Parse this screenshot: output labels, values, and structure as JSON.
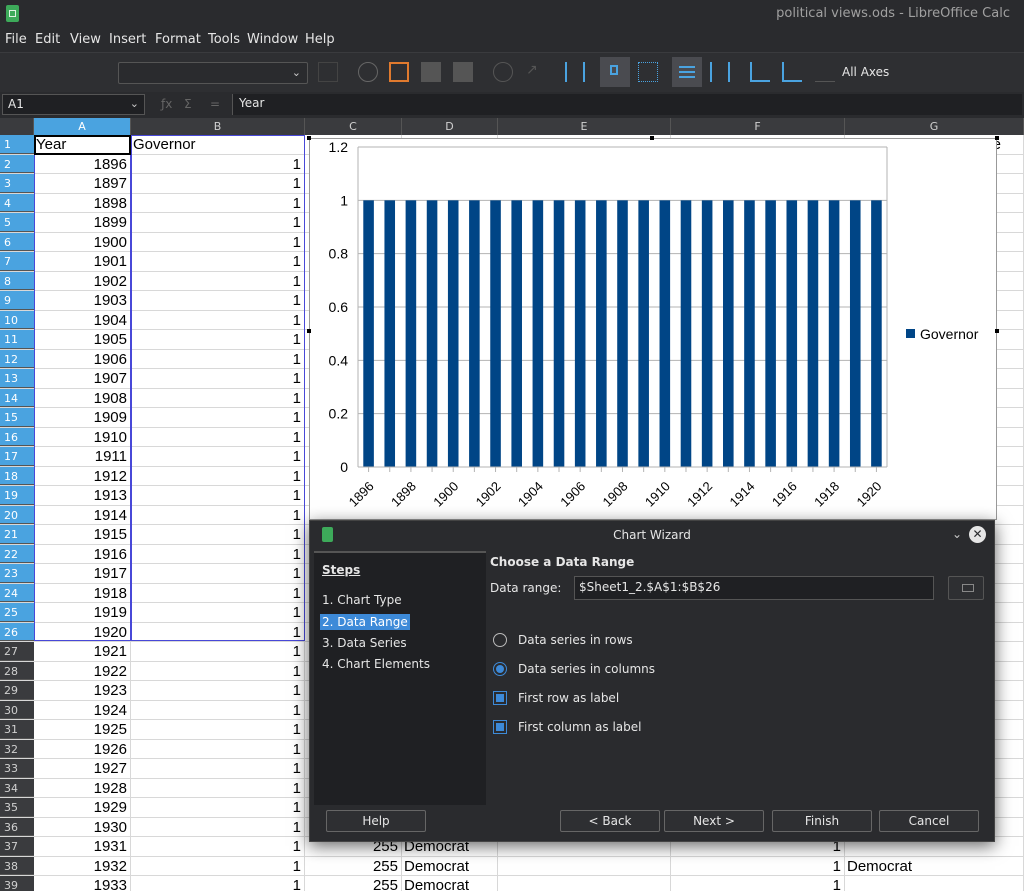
{
  "window": {
    "title": "political views.ods - LibreOffice Calc"
  },
  "menu": [
    "File",
    "Edit",
    "View",
    "Insert",
    "Format",
    "Tools",
    "Window",
    "Help"
  ],
  "toolbar": {
    "axes_label": "All Axes",
    "chart_element_select": ""
  },
  "formula_bar": {
    "cell_ref": "A1",
    "content": "Year"
  },
  "columns": [
    "A",
    "B",
    "C",
    "D",
    "E",
    "F",
    "G"
  ],
  "header_row": {
    "num": "1",
    "a": "Year",
    "b": "Governor",
    "g_partial": "e"
  },
  "rows": [
    {
      "num": "2",
      "a": "1896",
      "b": "1",
      "c": "",
      "d": "",
      "f": "",
      "g": ""
    },
    {
      "num": "3",
      "a": "1897",
      "b": "1",
      "c": "",
      "d": "",
      "f": "",
      "g": ""
    },
    {
      "num": "4",
      "a": "1898",
      "b": "1",
      "c": "",
      "d": "",
      "f": "",
      "g": ""
    },
    {
      "num": "5",
      "a": "1899",
      "b": "1",
      "c": "",
      "d": "",
      "f": "",
      "g": ""
    },
    {
      "num": "6",
      "a": "1900",
      "b": "1",
      "c": "",
      "d": "",
      "f": "",
      "g": ""
    },
    {
      "num": "7",
      "a": "1901",
      "b": "1",
      "c": "",
      "d": "",
      "f": "",
      "g": ""
    },
    {
      "num": "8",
      "a": "1902",
      "b": "1",
      "c": "",
      "d": "",
      "f": "",
      "g": ""
    },
    {
      "num": "9",
      "a": "1903",
      "b": "1",
      "c": "",
      "d": "",
      "f": "",
      "g": ""
    },
    {
      "num": "10",
      "a": "1904",
      "b": "1",
      "c": "",
      "d": "",
      "f": "",
      "g": ""
    },
    {
      "num": "11",
      "a": "1905",
      "b": "1",
      "c": "",
      "d": "",
      "f": "",
      "g": ""
    },
    {
      "num": "12",
      "a": "1906",
      "b": "1",
      "c": "",
      "d": "",
      "f": "",
      "g": ""
    },
    {
      "num": "13",
      "a": "1907",
      "b": "1",
      "c": "",
      "d": "",
      "f": "",
      "g": ""
    },
    {
      "num": "14",
      "a": "1908",
      "b": "1",
      "c": "",
      "d": "",
      "f": "",
      "g": ""
    },
    {
      "num": "15",
      "a": "1909",
      "b": "1",
      "c": "",
      "d": "",
      "f": "",
      "g": ""
    },
    {
      "num": "16",
      "a": "1910",
      "b": "1",
      "c": "",
      "d": "",
      "f": "",
      "g": ""
    },
    {
      "num": "17",
      "a": "1911",
      "b": "1",
      "c": "",
      "d": "",
      "f": "",
      "g": ""
    },
    {
      "num": "18",
      "a": "1912",
      "b": "1",
      "c": "",
      "d": "",
      "f": "",
      "g": ""
    },
    {
      "num": "19",
      "a": "1913",
      "b": "1",
      "c": "",
      "d": "",
      "f": "",
      "g": ""
    },
    {
      "num": "20",
      "a": "1914",
      "b": "1",
      "c": "",
      "d": "",
      "f": "",
      "g": ""
    },
    {
      "num": "21",
      "a": "1915",
      "b": "1",
      "c": "",
      "d": "",
      "f": "",
      "g": ""
    },
    {
      "num": "22",
      "a": "1916",
      "b": "1",
      "c": "",
      "d": "",
      "f": "",
      "g": ""
    },
    {
      "num": "23",
      "a": "1917",
      "b": "1",
      "c": "",
      "d": "",
      "f": "",
      "g": ""
    },
    {
      "num": "24",
      "a": "1918",
      "b": "1",
      "c": "",
      "d": "",
      "f": "",
      "g": ""
    },
    {
      "num": "25",
      "a": "1919",
      "b": "1",
      "c": "",
      "d": "",
      "f": "",
      "g": ""
    },
    {
      "num": "26",
      "a": "1920",
      "b": "1",
      "c": "",
      "d": "",
      "f": "",
      "g": ""
    },
    {
      "num": "27",
      "a": "1921",
      "b": "1",
      "c": "",
      "d": "",
      "f": "",
      "g": ""
    },
    {
      "num": "28",
      "a": "1922",
      "b": "1",
      "c": "",
      "d": "",
      "f": "",
      "g": ""
    },
    {
      "num": "29",
      "a": "1923",
      "b": "1",
      "c": "",
      "d": "",
      "f": "",
      "g": ""
    },
    {
      "num": "30",
      "a": "1924",
      "b": "1",
      "c": "",
      "d": "",
      "f": "",
      "g": ""
    },
    {
      "num": "31",
      "a": "1925",
      "b": "1",
      "c": "",
      "d": "",
      "f": "",
      "g": ""
    },
    {
      "num": "32",
      "a": "1926",
      "b": "1",
      "c": "",
      "d": "",
      "f": "",
      "g": ""
    },
    {
      "num": "33",
      "a": "1927",
      "b": "1",
      "c": "",
      "d": "",
      "f": "",
      "g": ""
    },
    {
      "num": "34",
      "a": "1928",
      "b": "1",
      "c": "",
      "d": "",
      "f": "",
      "g": ""
    },
    {
      "num": "35",
      "a": "1929",
      "b": "1",
      "c": "",
      "d": "",
      "f": "",
      "g": ""
    },
    {
      "num": "36",
      "a": "1930",
      "b": "1",
      "c": "",
      "d": "",
      "f": "",
      "g": ""
    },
    {
      "num": "37",
      "a": "1931",
      "b": "1",
      "c": "255",
      "d": "Democrat",
      "f": "1",
      "g": ""
    },
    {
      "num": "38",
      "a": "1932",
      "b": "1",
      "c": "255",
      "d": "Democrat",
      "f": "1",
      "g": "Democrat"
    },
    {
      "num": "39",
      "a": "1933",
      "b": "1",
      "c": "255",
      "d": "Democrat",
      "f": "1",
      "g": ""
    }
  ],
  "chart_data": {
    "type": "bar",
    "categories": [
      "1896",
      "1897",
      "1898",
      "1899",
      "1900",
      "1901",
      "1902",
      "1903",
      "1904",
      "1905",
      "1906",
      "1907",
      "1908",
      "1909",
      "1910",
      "1911",
      "1912",
      "1913",
      "1914",
      "1915",
      "1916",
      "1917",
      "1918",
      "1919",
      "1920"
    ],
    "x_tick_labels": [
      "1896",
      "1898",
      "1900",
      "1902",
      "1904",
      "1906",
      "1908",
      "1910",
      "1912",
      "1914",
      "1916",
      "1918",
      "1920"
    ],
    "series": [
      {
        "name": "Governor",
        "values": [
          1,
          1,
          1,
          1,
          1,
          1,
          1,
          1,
          1,
          1,
          1,
          1,
          1,
          1,
          1,
          1,
          1,
          1,
          1,
          1,
          1,
          1,
          1,
          1,
          1
        ]
      }
    ],
    "ylim": [
      0,
      1.2
    ],
    "y_ticks": [
      "0",
      "0.2",
      "0.4",
      "0.6",
      "0.8",
      "1",
      "1.2"
    ],
    "grid": true,
    "legend_position": "right",
    "bar_color": "#004586"
  },
  "wizard": {
    "title": "Chart Wizard",
    "steps_heading": "Steps",
    "steps": [
      "1. Chart Type",
      "2. Data Range",
      "3. Data Series",
      "4. Chart Elements"
    ],
    "active_step": 1,
    "heading": "Choose a Data Range",
    "data_range_label": "Data range:",
    "data_range_value": "$Sheet1_2.$A$1:$B$26",
    "opt_rows": "Data series in rows",
    "opt_columns": "Data series in columns",
    "opt_first_row": "First row as label",
    "opt_first_col": "First column as label",
    "btn_help": "Help",
    "btn_back": "< Back",
    "btn_next": "Next >",
    "btn_finish": "Finish",
    "btn_cancel": "Cancel"
  },
  "colors": {
    "accent": "#3d8ad8",
    "selection": "#4848d8",
    "bar": "#004586"
  }
}
